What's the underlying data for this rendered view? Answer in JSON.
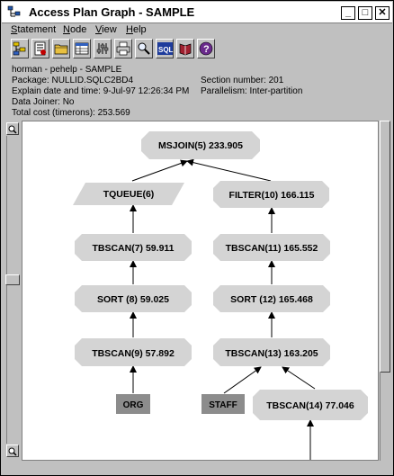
{
  "window": {
    "title": "Access Plan Graph - SAMPLE",
    "minimize": "_",
    "maximize": "□",
    "close": "✕"
  },
  "menu": {
    "items": [
      {
        "label": "Statement",
        "mnemonic": "S",
        "rest": "tatement"
      },
      {
        "label": "Node",
        "mnemonic": "N",
        "rest": "ode"
      },
      {
        "label": "View",
        "mnemonic": "V",
        "rest": "iew"
      },
      {
        "label": "Help",
        "mnemonic": "H",
        "rest": "elp"
      }
    ]
  },
  "toolbar": {
    "buttons": [
      {
        "icon": "open-statement-icon"
      },
      {
        "icon": "statement-details-icon"
      },
      {
        "icon": "folder-icon"
      },
      {
        "icon": "table-details-icon"
      },
      {
        "icon": "settings-icon"
      },
      {
        "icon": "print-icon"
      },
      {
        "icon": "zoom-icon"
      },
      {
        "icon": "sql-icon",
        "label": "SQL"
      },
      {
        "icon": "book-icon"
      },
      {
        "icon": "help-icon",
        "label": "?"
      }
    ]
  },
  "info": {
    "user": "horman - pehelp - SAMPLE",
    "package": "Package: NULLID.SQLC2BD4",
    "section": "Section number: 201",
    "explain_date": "Explain date and time: 9-Jul-97 12:26:34 PM",
    "parallelism": "Parallelism: Inter-partition",
    "data_joiner": "Data Joiner: No",
    "total_cost": "Total cost (timerons): 253.569"
  },
  "zoom": {
    "top_label": "🔍",
    "bottom_label": "🔍"
  },
  "graph": {
    "colors": {
      "node_fill": "#d4d4d4",
      "table_fill": "#8c8c8c",
      "edge": "#000000"
    },
    "nodes": {
      "msjoin": "MSJOIN(5) 233.905",
      "tqueue": "TQUEUE(6)",
      "filter": "FILTER(10) 166.115",
      "tbscan7": "TBSCAN(7) 59.911",
      "tbscan11": "TBSCAN(11) 165.552",
      "sort8": "SORT (8) 59.025",
      "sort12": "SORT (12) 165.468",
      "tbscan9": "TBSCAN(9) 57.892",
      "tbscan13": "TBSCAN(13) 163.205",
      "tbscan14": "TBSCAN(14) 77.046"
    },
    "tables": {
      "org": "ORG",
      "staff": "STAFF"
    }
  }
}
